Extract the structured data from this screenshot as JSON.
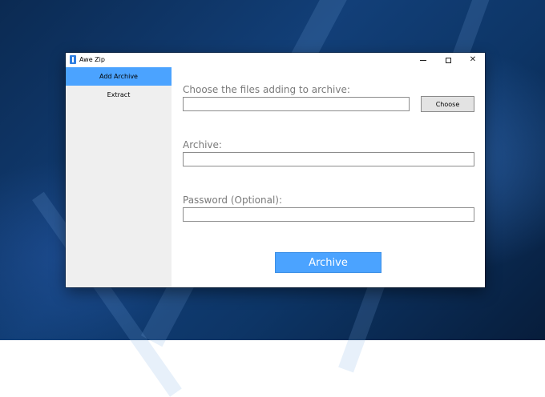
{
  "window": {
    "title": "Awe Zip",
    "controls": {
      "minimize_icon": "minimize-icon",
      "maximize_icon": "maximize-icon",
      "close_icon": "close-icon"
    }
  },
  "sidebar": {
    "items": [
      {
        "label": "Add Archive",
        "active": true
      },
      {
        "label": "Extract",
        "active": false
      }
    ]
  },
  "form": {
    "files_label": "Choose the files adding to archive:",
    "files_value": "",
    "choose_label": "Choose",
    "archive_label": "Archive:",
    "archive_value": "",
    "password_label": "Password (Optional):",
    "password_value": "",
    "submit_label": "Archive"
  },
  "colors": {
    "accent": "#4ba3ff",
    "sidebar_bg": "#efefef",
    "label_text": "#7a7a7a"
  }
}
